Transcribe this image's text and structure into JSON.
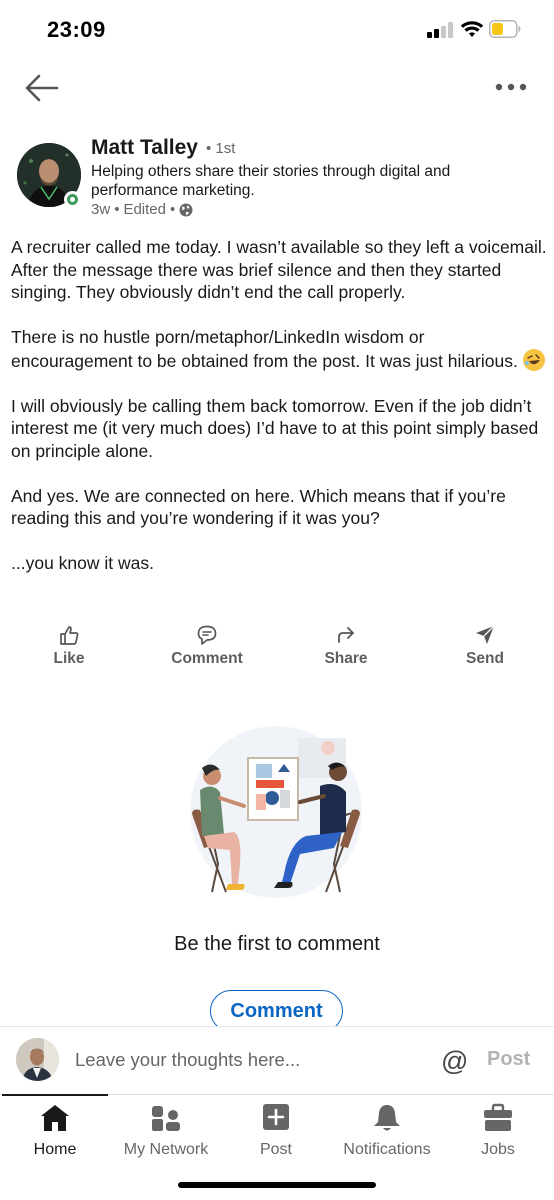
{
  "status_bar": {
    "time": "23:09"
  },
  "nav": {
    "back_icon": "arrow-left-icon",
    "more_icon": "more-horizontal-icon"
  },
  "author": {
    "name": "Matt Talley",
    "degree": "• 1st",
    "headline": "Helping others share their stories through digital and performance marketing.",
    "time_ago": "3w",
    "edited": "Edited",
    "visibility_icon": "globe-icon"
  },
  "post": {
    "paragraphs": [
      "A recruiter called me today. I wasn’t available so they left a voicemail. After the message there was brief silence and then they started singing. They obviously didn’t end the call properly.",
      "There is no hustle porn/metaphor/LinkedIn wisdom or encouragement to be obtained from the post. It was just hilarious.",
      "I will obviously be calling them back tomorrow. Even if the job didn’t interest me (it very much does) I’d have to at this point simply based on principle alone.",
      "And yes. We are connected on here. Which means that if you’re reading this and you’re wondering if it was you?",
      "...you know it was."
    ]
  },
  "actions": {
    "like": "Like",
    "comment": "Comment",
    "share": "Share",
    "send": "Send"
  },
  "comments": {
    "empty_title": "Be the first to comment",
    "comment_button": "Comment"
  },
  "composer": {
    "placeholder": "Leave your thoughts here...",
    "mention": "@",
    "post": "Post"
  },
  "tabs": {
    "home": "Home",
    "network": "My Network",
    "post": "Post",
    "notifications": "Notifications",
    "jobs": "Jobs"
  },
  "colors": {
    "brand": "#0a66c2",
    "online": "#3c9a5a",
    "text": "#191919",
    "muted": "#666666"
  }
}
